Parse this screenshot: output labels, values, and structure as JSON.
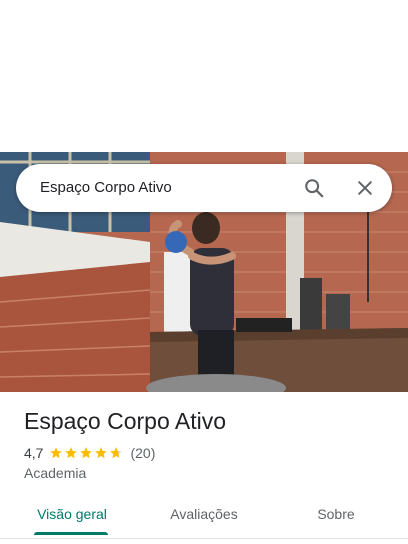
{
  "search": {
    "query": "Espaço Corpo Ativo",
    "search_icon": "search-icon",
    "close_icon": "close-icon"
  },
  "place": {
    "name": "Espaço Corpo Ativo",
    "rating": "4,7",
    "rating_value": 4.7,
    "review_count": "(20)",
    "category": "Academia"
  },
  "tabs": [
    {
      "label": "Visão geral",
      "selected": true
    },
    {
      "label": "Avaliações",
      "selected": false
    },
    {
      "label": "Sobre",
      "selected": false
    }
  ],
  "colors": {
    "accent": "#00796b",
    "star": "#fbbc04",
    "text_primary": "#202124",
    "text_secondary": "#5f6368"
  }
}
